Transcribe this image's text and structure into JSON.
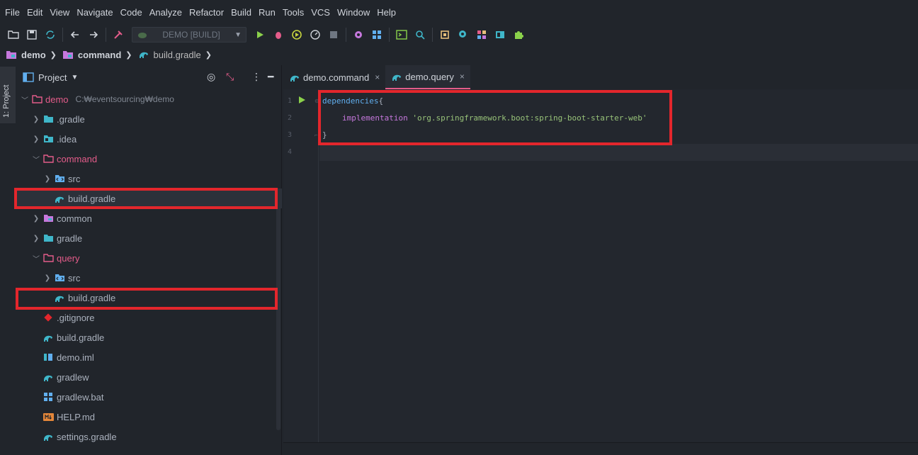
{
  "menu": [
    "File",
    "Edit",
    "View",
    "Navigate",
    "Code",
    "Analyze",
    "Refactor",
    "Build",
    "Run",
    "Tools",
    "VCS",
    "Window",
    "Help"
  ],
  "toolbar": {
    "run_config": "DEMO [BUILD]"
  },
  "breadcrumb": {
    "root": "demo",
    "module": "command",
    "file": "build.gradle"
  },
  "toolstrip": {
    "project_tab": "1: Project"
  },
  "project_panel": {
    "title": "Project",
    "root": {
      "label": "demo",
      "path": "C:₩eventsourcing₩demo"
    },
    "items": [
      {
        "label": ".gradle"
      },
      {
        "label": ".idea"
      },
      {
        "label": "command"
      },
      {
        "label": "src"
      },
      {
        "label": "build.gradle"
      },
      {
        "label": "common"
      },
      {
        "label": "gradle"
      },
      {
        "label": "query"
      },
      {
        "label": "src"
      },
      {
        "label": "build.gradle"
      },
      {
        "label": ".gitignore"
      },
      {
        "label": "build.gradle"
      },
      {
        "label": "demo.iml"
      },
      {
        "label": "gradlew"
      },
      {
        "label": "gradlew.bat"
      },
      {
        "label": "HELP.md"
      },
      {
        "label": "settings.gradle"
      }
    ]
  },
  "editor": {
    "tabs": [
      {
        "label": "demo.command",
        "close": "×"
      },
      {
        "label": "demo.query",
        "close": "×"
      }
    ],
    "line_numbers": [
      "1",
      "2",
      "3",
      "4"
    ],
    "code": {
      "line1_kw": "dependencies",
      "line1_brace": "{",
      "line2_fn": "implementation",
      "line2_str": "'org.springframework.boot:spring-boot-starter-web'",
      "line3_brace": "}"
    }
  },
  "colors": {
    "accent_pink": "#e45c8a",
    "highlight_red": "#e3262c",
    "gradle_teal": "#3fb6c9"
  }
}
